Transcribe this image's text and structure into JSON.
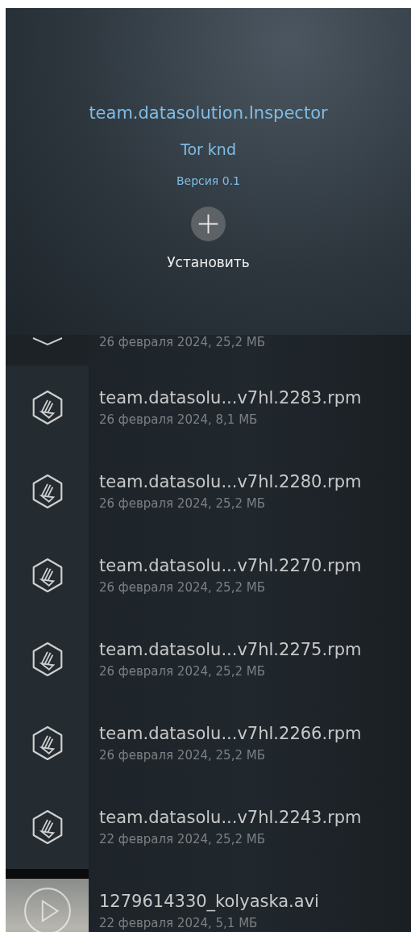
{
  "install_panel": {
    "package": "team.datasolution.Inspector",
    "app_name": "Tor knd",
    "version": "Версия 0.1",
    "action": "Установить"
  },
  "files": [
    {
      "kind": "partial",
      "meta": "26 февраля 2024, 25,2 МБ"
    },
    {
      "kind": "package",
      "name": "team.datasolu...v7hl.2283.rpm",
      "meta": "26 февраля 2024, 8,1 МБ"
    },
    {
      "kind": "package",
      "name": "team.datasolu...v7hl.2280.rpm",
      "meta": "26 февраля 2024, 25,2 МБ"
    },
    {
      "kind": "package",
      "name": "team.datasolu...v7hl.2270.rpm",
      "meta": "26 февраля 2024, 25,2 МБ"
    },
    {
      "kind": "package",
      "name": "team.datasolu...v7hl.2275.rpm",
      "meta": "26 февраля 2024, 25,2 МБ"
    },
    {
      "kind": "package",
      "name": "team.datasolu...v7hl.2266.rpm",
      "meta": "26 февраля 2024, 25,2 МБ"
    },
    {
      "kind": "package",
      "name": "team.datasolu...v7hl.2243.rpm",
      "meta": "22 февраля 2024, 25,2 МБ"
    },
    {
      "kind": "video",
      "name": "1279614330_kolyaska.avi",
      "meta": "22 февраля 2024, 5,1 МБ"
    }
  ]
}
